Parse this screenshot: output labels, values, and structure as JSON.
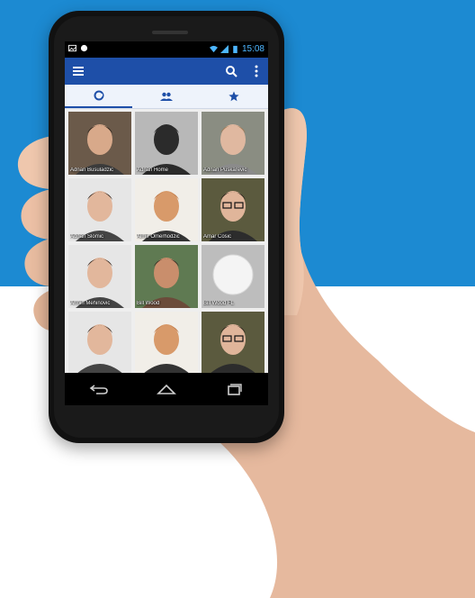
{
  "status_bar": {
    "time": "15:08"
  },
  "app_bar": {
    "icons": [
      "menu-icon",
      "search-icon",
      "more-vert-icon"
    ]
  },
  "tabs": [
    {
      "icon": "recent-icon",
      "active": true
    },
    {
      "icon": "people-icon",
      "active": false
    },
    {
      "icon": "star-icon",
      "active": false
    }
  ],
  "contacts": [
    {
      "name": "Adnan Busuladzic",
      "style": "photo-dark"
    },
    {
      "name": "Adnan Home",
      "style": "silhouette"
    },
    {
      "name": "Adnan Puskarevic",
      "style": "photo-bridge"
    },
    {
      "name": "Adnan Slomic",
      "style": "photo-light"
    },
    {
      "name": "Almir Omerhodzic",
      "style": "photo-warm"
    },
    {
      "name": "Amar Cosic",
      "style": "photo-glasses"
    },
    {
      "name": "Armin Mehinovic",
      "style": "photo-light"
    },
    {
      "name": "Bill Wood",
      "style": "photo-outdoor"
    },
    {
      "name": "Bill Wood FL",
      "style": "placeholder-circle"
    },
    {
      "name": "",
      "style": "photo-light"
    },
    {
      "name": "",
      "style": "photo-warm"
    },
    {
      "name": "",
      "style": "photo-glasses"
    }
  ],
  "nav_bar": {
    "icons": [
      "back-icon",
      "home-icon",
      "recents-icon"
    ]
  },
  "colors": {
    "background_top": "#1c8ad2",
    "app_bar": "#1e4fa8",
    "accent_status": "#4db6ff"
  }
}
